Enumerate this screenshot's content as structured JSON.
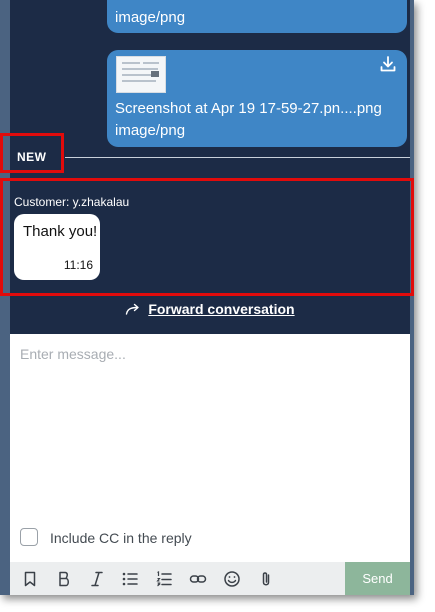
{
  "messages": [
    {
      "mime": "image/png"
    },
    {
      "filename": "Screenshot at Apr 19 17-59-27.pn....png",
      "mime": "image/png",
      "download_icon": "download-icon"
    }
  ],
  "divider": {
    "label": "NEW"
  },
  "incoming": {
    "sender": "Customer: y.zhakalau",
    "text": "Thank you!",
    "time": "11:16"
  },
  "forward": {
    "icon": "forward-arrow-icon",
    "label": "Forward conversation"
  },
  "composer": {
    "placeholder": "Enter message...",
    "cc_label": "Include CC in the reply",
    "cc_checked": false
  },
  "toolbar": {
    "icons": [
      "bookmark-icon",
      "bold-icon",
      "italic-icon",
      "bulleted-list-icon",
      "numbered-list-icon",
      "link-icon",
      "emoji-icon",
      "attachment-icon"
    ],
    "send_label": "Send"
  },
  "colors": {
    "chat_bg": "#1c2b46",
    "bubble_out": "#3f86c6",
    "send_button": "#8db69b",
    "highlight": "#e10b0b"
  }
}
